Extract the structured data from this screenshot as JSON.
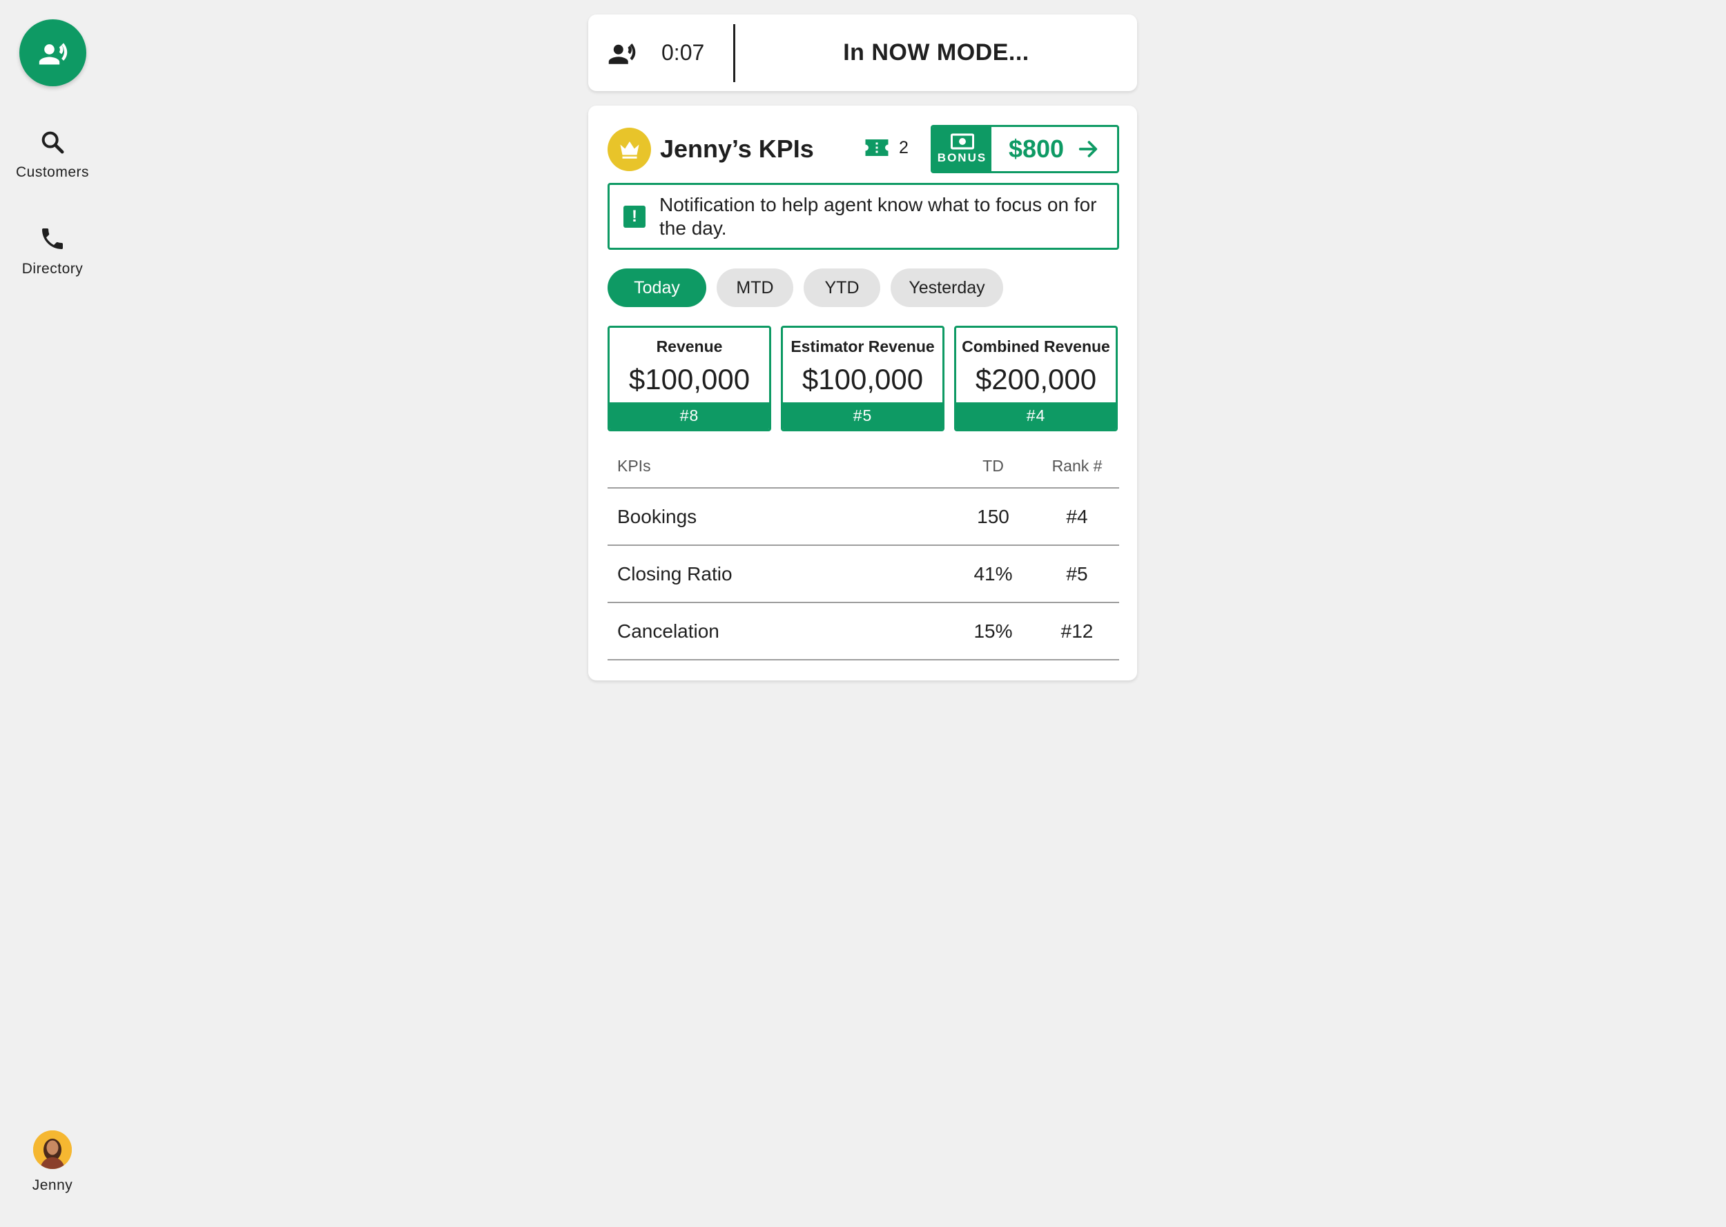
{
  "app": {
    "accent_color": "#0e9a64",
    "crown_color": "#e8c42a"
  },
  "rail": {
    "fab_icon": "voice-call-icon",
    "items": [
      {
        "label": "Customers",
        "icon": "search-icon"
      },
      {
        "label": "Directory",
        "icon": "phone-icon"
      }
    ],
    "user": {
      "name": "Jenny",
      "icon": "avatar"
    }
  },
  "topbar": {
    "icon": "voice-icon",
    "timer": "0:07",
    "mode": "In NOW MODE..."
  },
  "kpi_card": {
    "title": "Jenny’s KPIs",
    "ticket_count": "2",
    "bonus": {
      "tag": "BONUS",
      "amount": "$800"
    },
    "notification": "Notification to help agent know what to focus on for the day.",
    "chips": [
      {
        "label": "Today",
        "active": true
      },
      {
        "label": "MTD",
        "active": false
      },
      {
        "label": "YTD",
        "active": false
      },
      {
        "label": "Yesterday",
        "active": false
      }
    ],
    "tiles": [
      {
        "label": "Revenue",
        "value": "$100,000",
        "rank": "#8"
      },
      {
        "label": "Estimator Revenue",
        "value": "$100,000",
        "rank": "#5"
      },
      {
        "label": "Combined Revenue",
        "value": "$200,000",
        "rank": "#4"
      }
    ],
    "table": {
      "headers": [
        "KPIs",
        "TD",
        "Rank #"
      ],
      "rows": [
        [
          "Bookings",
          "150",
          "#4"
        ],
        [
          "Closing Ratio",
          "41%",
          "#5"
        ],
        [
          "Cancelation",
          "15%",
          "#12"
        ]
      ]
    }
  }
}
